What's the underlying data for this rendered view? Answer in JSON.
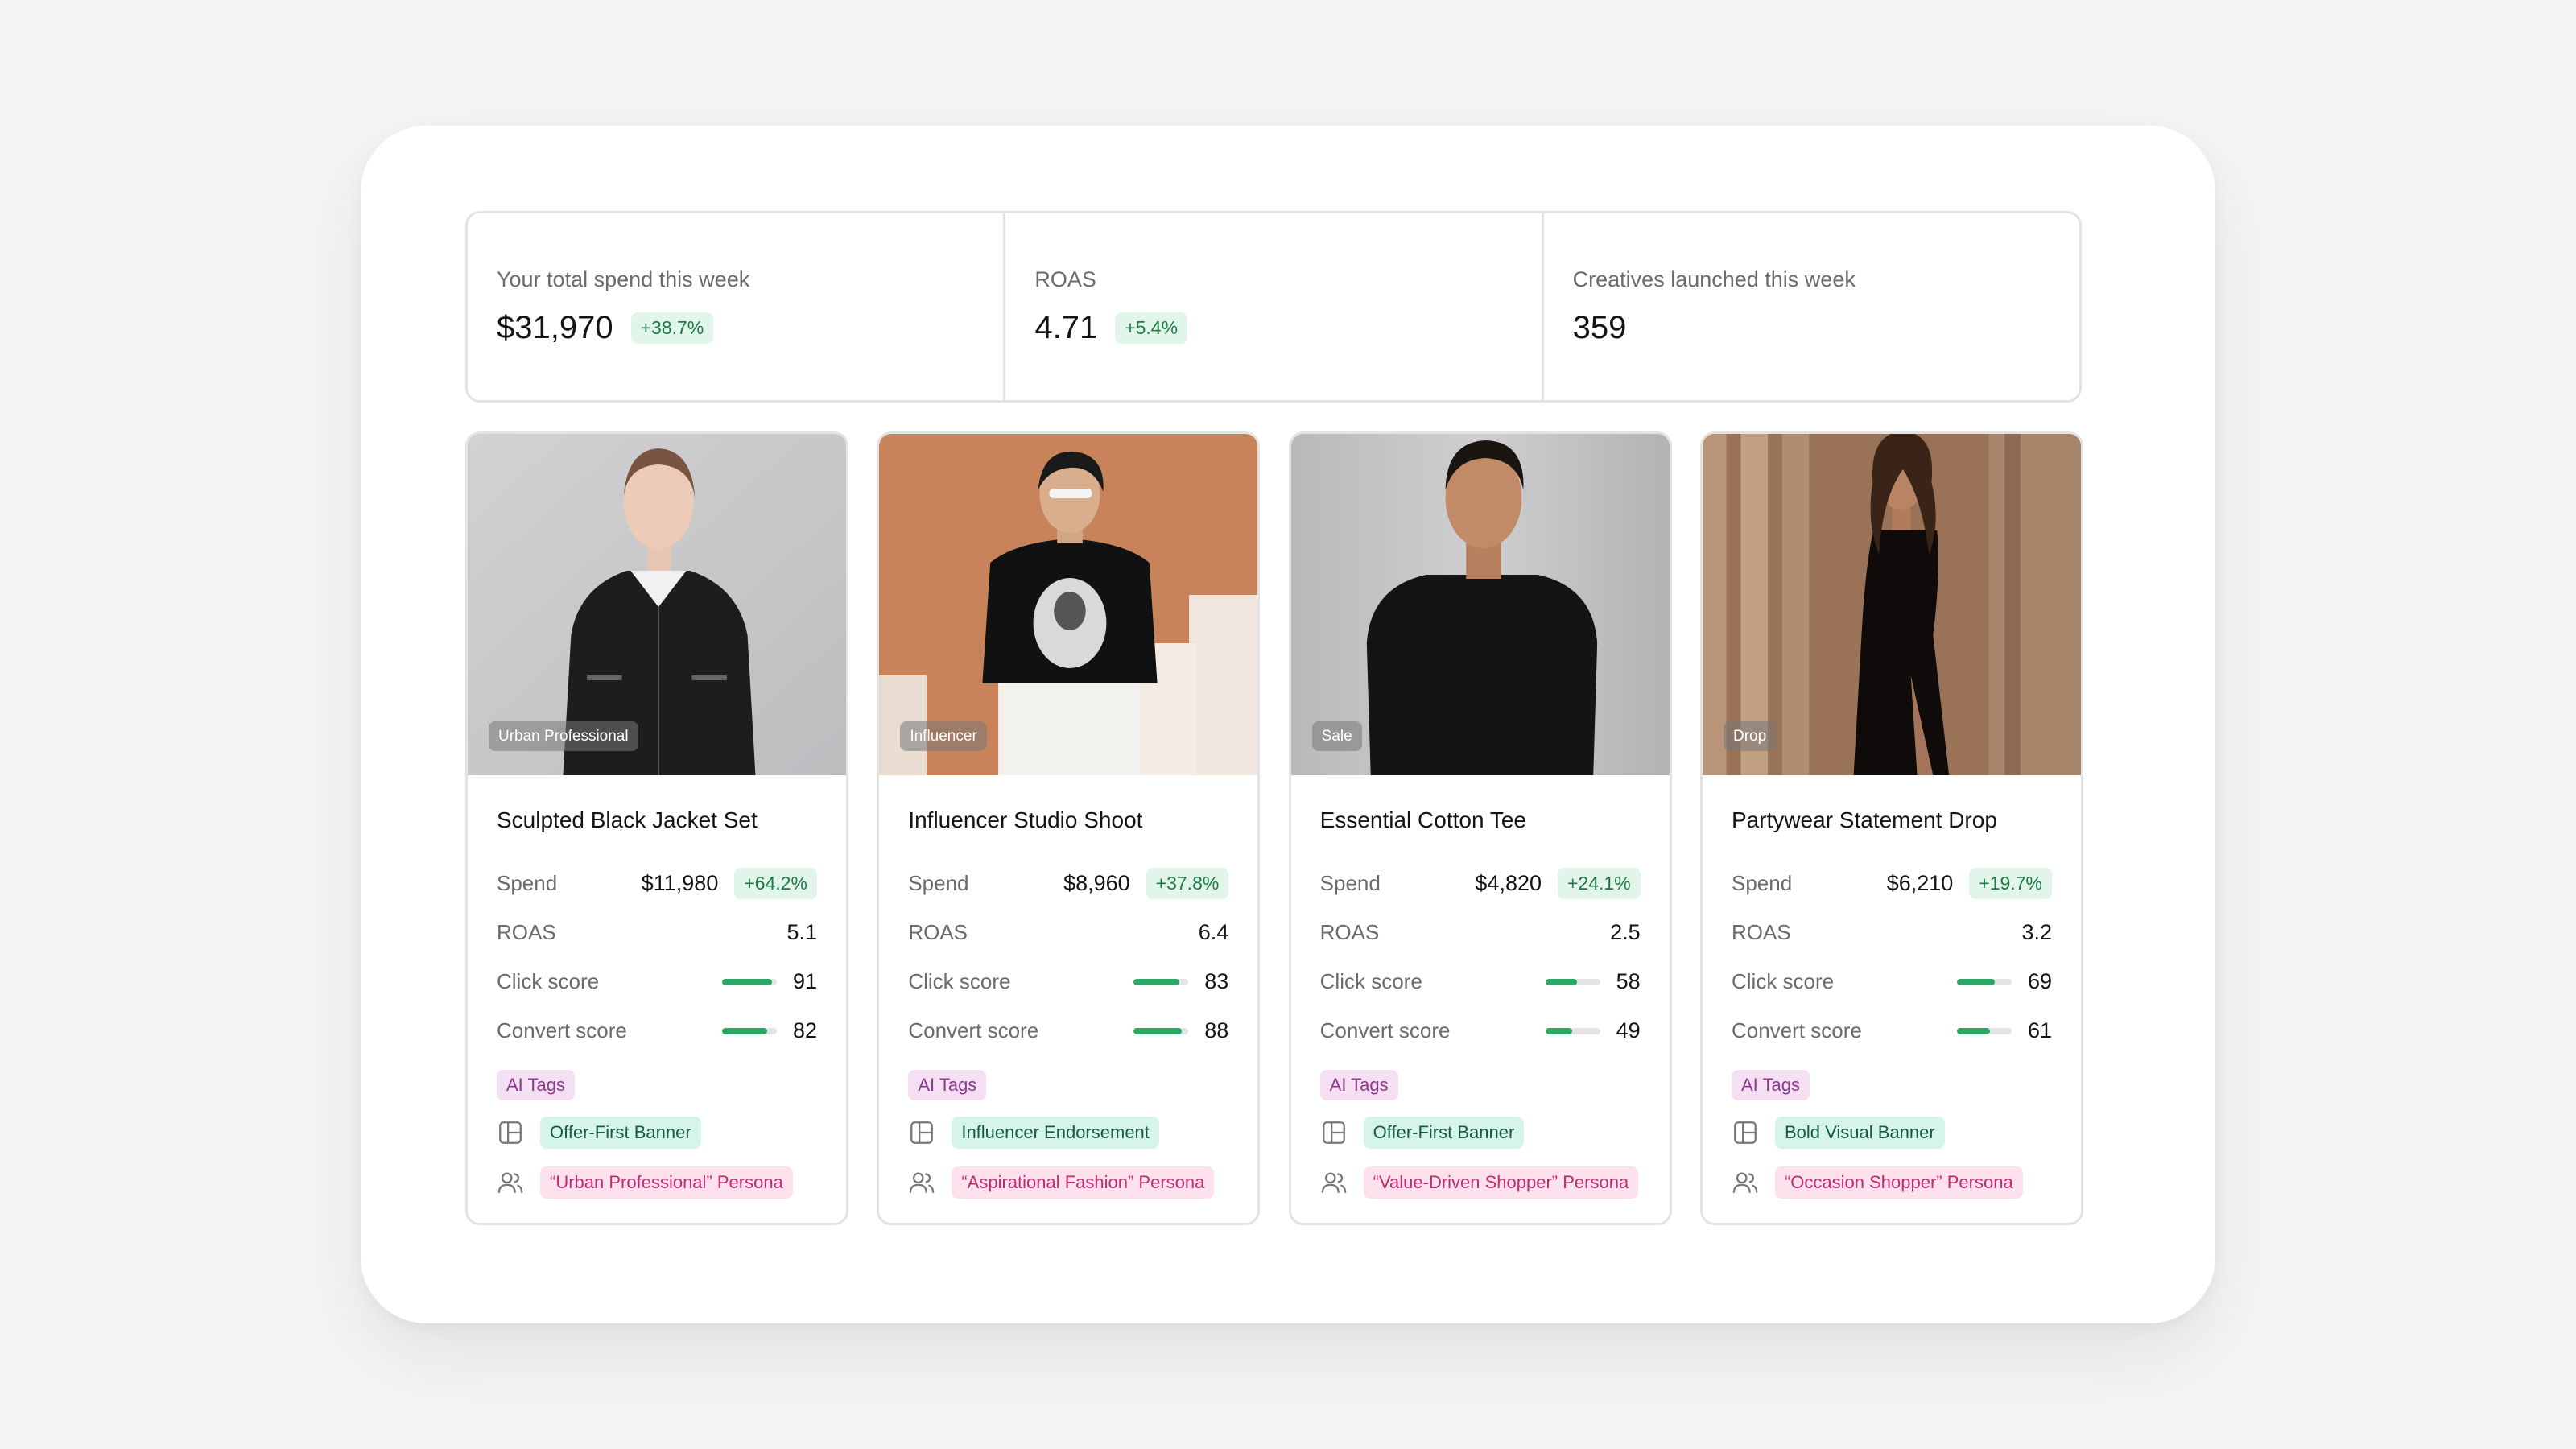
{
  "stats": [
    {
      "label": "Your total spend this week",
      "value": "$31,970",
      "change": "+38.7%"
    },
    {
      "label": "ROAS",
      "value": "4.71",
      "change": "+5.4%"
    },
    {
      "label": "Creatives launched this week",
      "value": "359",
      "change": null
    }
  ],
  "labels": {
    "spend": "Spend",
    "roas": "ROAS",
    "click": "Click score",
    "convert": "Convert score",
    "ai_tags": "AI Tags"
  },
  "cards": [
    {
      "tag": "Urban Professional",
      "title": "Sculpted Black Jacket Set",
      "spend": "$11,980",
      "spend_change": "+64.2%",
      "roas": "5.1",
      "click": "91",
      "click_pct": 91,
      "convert": "82",
      "convert_pct": 82,
      "format_tag": "Offer-First Banner",
      "persona_tag": "“Urban Professional” Persona"
    },
    {
      "tag": "Influencer",
      "title": "Influencer Studio Shoot",
      "spend": "$8,960",
      "spend_change": "+37.8%",
      "roas": "6.4",
      "click": "83",
      "click_pct": 83,
      "convert": "88",
      "convert_pct": 88,
      "format_tag": "Influencer Endorsement",
      "persona_tag": "“Aspirational Fashion” Persona"
    },
    {
      "tag": "Sale",
      "title": "Essential Cotton Tee",
      "spend": "$4,820",
      "spend_change": "+24.1%",
      "roas": "2.5",
      "click": "58",
      "click_pct": 58,
      "convert": "49",
      "convert_pct": 49,
      "format_tag": "Offer-First Banner",
      "persona_tag": "“Value-Driven Shopper” Persona"
    },
    {
      "tag": "Drop",
      "title": "Partywear Statement Drop",
      "spend": "$6,210",
      "spend_change": "+19.7%",
      "roas": "3.2",
      "click": "69",
      "click_pct": 69,
      "convert": "61",
      "convert_pct": 61,
      "format_tag": "Bold Visual Banner",
      "persona_tag": "“Occasion Shopper” Persona"
    }
  ],
  "colors": {
    "accent_green": "#2ca865",
    "badge_green_bg": "#e2f5ea",
    "ai_tag_bg": "#f4dff3",
    "persona_pink": "#c22a6f"
  },
  "icons": [
    "layout-icon",
    "users-icon"
  ]
}
